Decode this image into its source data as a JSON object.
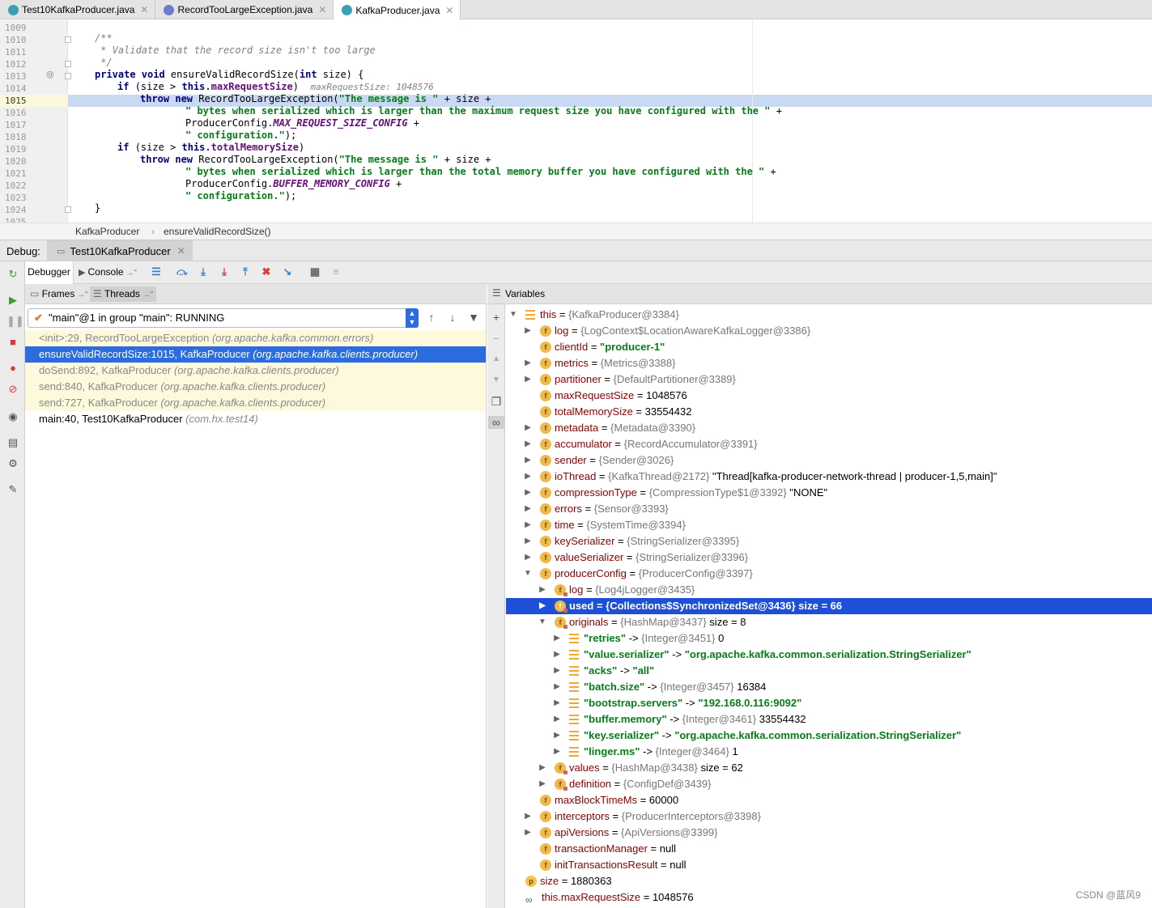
{
  "tabs": [
    {
      "label": "Test10KafkaProducer.java"
    },
    {
      "label": "RecordTooLargeException.java"
    },
    {
      "label": "KafkaProducer.java"
    }
  ],
  "gutter": {
    "lines": [
      "1009",
      "1010",
      "1011",
      "1012",
      "1013",
      "1014",
      "1015",
      "1016",
      "1017",
      "1018",
      "1019",
      "1020",
      "1021",
      "1022",
      "1023",
      "1024",
      "1025"
    ],
    "annotation_mark": "@"
  },
  "code": {
    "l1010": "/**",
    "l1011": " * Validate that the record size isn't too large",
    "l1012": " */",
    "l1013_a": "private void ",
    "l1013_b": "ensureValidRecordSize(",
    "l1013_c": "int ",
    "l1013_d": "size) {",
    "l1014_a": "if ",
    "l1014_b": "(size > ",
    "l1014_c": "this",
    "l1014_d": ".maxRequestSize",
    "l1014_e": ")",
    "l1014_hint": "maxRequestSize: 1048576",
    "l1015_a": "throw new ",
    "l1015_b": "RecordTooLargeException(",
    "l1015_c": "\"The message is \"",
    "l1015_d": " + size +",
    "l1016_a": "\" bytes when serialized which is larger than the maximum request size you have configured with the \"",
    "l1016_b": " +",
    "l1017_a": "ProducerConfig.",
    "l1017_b": "MAX_REQUEST_SIZE_CONFIG",
    "l1017_c": " +",
    "l1018_a": "\" configuration.\"",
    "l1018_b": ");",
    "l1019_a": "if ",
    "l1019_b": "(size > ",
    "l1019_c": "this",
    "l1019_d": ".totalMemorySize",
    "l1019_e": ")",
    "l1020_a": "throw new ",
    "l1020_b": "RecordTooLargeException(",
    "l1020_c": "\"The message is \"",
    "l1020_d": " + size +",
    "l1021_a": "\" bytes when serialized which is larger than the total memory buffer you have configured with the \"",
    "l1021_b": " +",
    "l1022_a": "ProducerConfig.",
    "l1022_b": "BUFFER_MEMORY_CONFIG",
    "l1022_c": " +",
    "l1023_a": "\" configuration.\"",
    "l1023_b": ");",
    "l1024": "}"
  },
  "breadcrumb": {
    "class": "KafkaProducer",
    "method": "ensureValidRecordSize()"
  },
  "debug": {
    "label": "Debug:",
    "session_tab": "Test10KafkaProducer"
  },
  "debugger_toolbar": {
    "debugger": "Debugger",
    "console": "Console"
  },
  "frames_panel": {
    "frames": "Frames",
    "threads": "Threads"
  },
  "thread_selector": "\"main\"@1 in group \"main\": RUNNING",
  "frames": [
    {
      "method": "<init>:29, RecordTooLargeException",
      "pkg": "(org.apache.kafka.common.errors)"
    },
    {
      "method": "ensureValidRecordSize:1015, KafkaProducer",
      "pkg": "(org.apache.kafka.clients.producer)"
    },
    {
      "method": "doSend:892, KafkaProducer",
      "pkg": "(org.apache.kafka.clients.producer)"
    },
    {
      "method": "send:840, KafkaProducer",
      "pkg": "(org.apache.kafka.clients.producer)"
    },
    {
      "method": "send:727, KafkaProducer",
      "pkg": "(org.apache.kafka.clients.producer)"
    },
    {
      "method": "main:40, Test10KafkaProducer",
      "pkg": "(com.hx.test14)"
    }
  ],
  "variables_title": "Variables",
  "vars": [
    {
      "name": "this",
      "eq": " = ",
      "ref": "{KafkaProducer@3384}"
    },
    {
      "name": "log",
      "eq": " = ",
      "ref": "{LogContext$LocationAwareKafkaLogger@3386}"
    },
    {
      "name": "clientId",
      "eq": " = ",
      "str": "\"producer-1\""
    },
    {
      "name": "metrics",
      "eq": " = ",
      "ref": "{Metrics@3388}"
    },
    {
      "name": "partitioner",
      "eq": " = ",
      "ref": "{DefaultPartitioner@3389}"
    },
    {
      "name": "maxRequestSize",
      "eq": " = ",
      "val": "1048576"
    },
    {
      "name": "totalMemorySize",
      "eq": " = ",
      "val": "33554432"
    },
    {
      "name": "metadata",
      "eq": " = ",
      "ref": "{Metadata@3390}"
    },
    {
      "name": "accumulator",
      "eq": " = ",
      "ref": "{RecordAccumulator@3391}"
    },
    {
      "name": "sender",
      "eq": " = ",
      "ref": "{Sender@3026}"
    },
    {
      "name": "ioThread",
      "eq": " = ",
      "ref": "{KafkaThread@2172}",
      "val": " \"Thread[kafka-producer-network-thread | producer-1,5,main]\""
    },
    {
      "name": "compressionType",
      "eq": " = ",
      "ref": "{CompressionType$1@3392}",
      "val": " \"NONE\""
    },
    {
      "name": "errors",
      "eq": " = ",
      "ref": "{Sensor@3393}"
    },
    {
      "name": "time",
      "eq": " = ",
      "ref": "{SystemTime@3394}"
    },
    {
      "name": "keySerializer",
      "eq": " = ",
      "ref": "{StringSerializer@3395}"
    },
    {
      "name": "valueSerializer",
      "eq": " = ",
      "ref": "{StringSerializer@3396}"
    },
    {
      "name": "producerConfig",
      "eq": " = ",
      "ref": "{ProducerConfig@3397}"
    },
    {
      "name": "log",
      "eq": " = ",
      "ref": "{Log4jLogger@3435}"
    },
    {
      "name": "used",
      "eq": " = ",
      "ref": "{Collections$SynchronizedSet@3436}",
      "val": "  size = 66"
    },
    {
      "name": "originals",
      "eq": " = ",
      "ref": "{HashMap@3437}",
      "val": "  size = 8"
    },
    {
      "name": "\"retries\"",
      "eq": " -> ",
      "ref": "{Integer@3451}",
      "val": " 0"
    },
    {
      "name": "\"value.serializer\"",
      "eq": " -> ",
      "str": "\"org.apache.kafka.common.serialization.StringSerializer\""
    },
    {
      "name": "\"acks\"",
      "eq": " -> ",
      "str": "\"all\""
    },
    {
      "name": "\"batch.size\"",
      "eq": " -> ",
      "ref": "{Integer@3457}",
      "val": " 16384"
    },
    {
      "name": "\"bootstrap.servers\"",
      "eq": " -> ",
      "str": "\"192.168.0.116:9092\""
    },
    {
      "name": "\"buffer.memory\"",
      "eq": " -> ",
      "ref": "{Integer@3461}",
      "val": " 33554432"
    },
    {
      "name": "\"key.serializer\"",
      "eq": " -> ",
      "str": "\"org.apache.kafka.common.serialization.StringSerializer\""
    },
    {
      "name": "\"linger.ms\"",
      "eq": " -> ",
      "ref": "{Integer@3464}",
      "val": " 1"
    },
    {
      "name": "values",
      "eq": " = ",
      "ref": "{HashMap@3438}",
      "val": "  size = 62"
    },
    {
      "name": "definition",
      "eq": " = ",
      "ref": "{ConfigDef@3439}"
    },
    {
      "name": "maxBlockTimeMs",
      "eq": " = ",
      "val": "60000"
    },
    {
      "name": "interceptors",
      "eq": " = ",
      "ref": "{ProducerInterceptors@3398}"
    },
    {
      "name": "apiVersions",
      "eq": " = ",
      "ref": "{ApiVersions@3399}"
    },
    {
      "name": "transactionManager",
      "eq": " = ",
      "val": "null"
    },
    {
      "name": "initTransactionsResult",
      "eq": " = ",
      "val": "null"
    },
    {
      "name": "size",
      "eq": " = ",
      "val": "1880363"
    },
    {
      "name": "this.maxRequestSize",
      "eq": " = ",
      "val": "1048576"
    }
  ],
  "watermark": "CSDN @蓝风9"
}
